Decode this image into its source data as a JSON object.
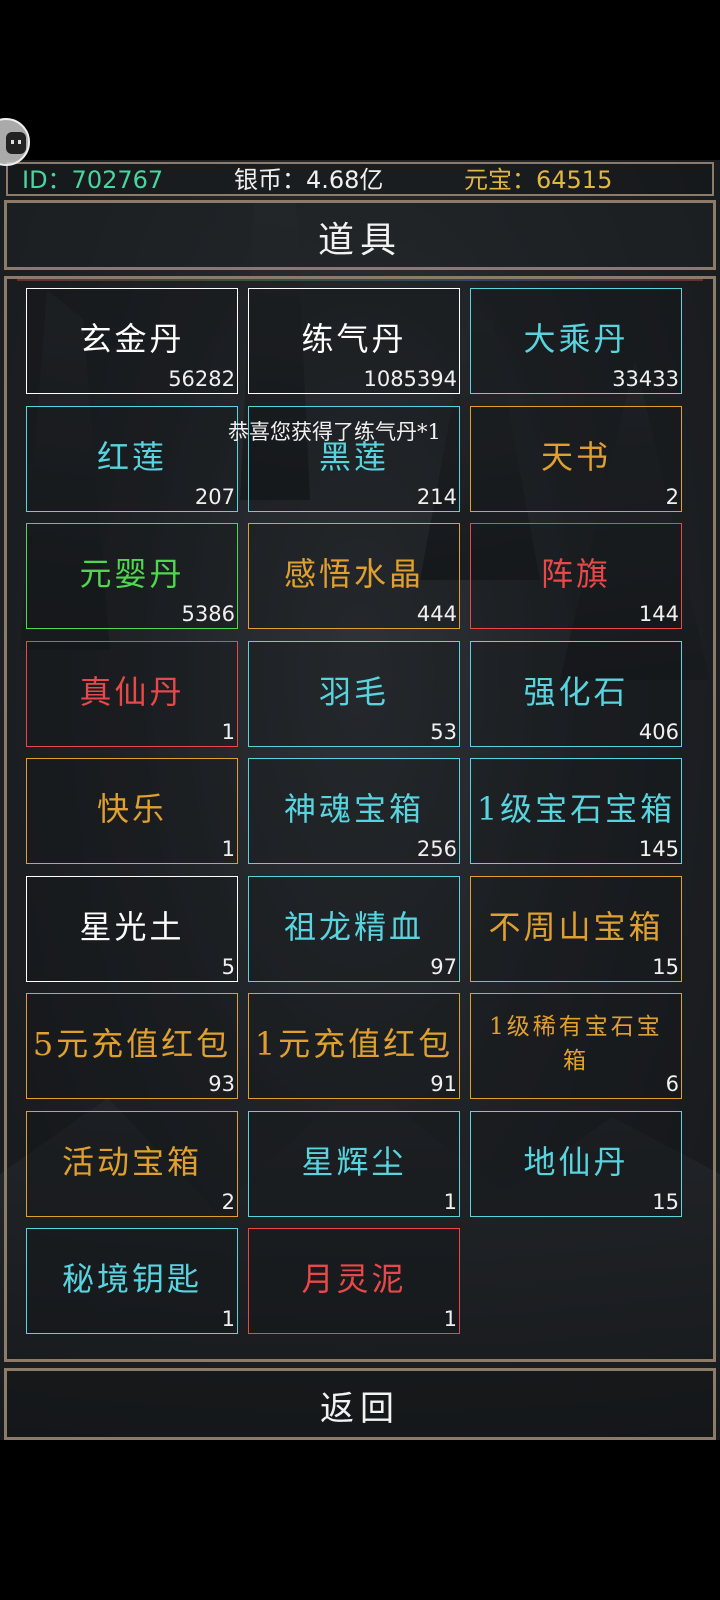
{
  "status": {
    "id_text": "ID：702767",
    "silver_text": "银币：4.68亿",
    "yuanbao_text": "元宝：64515",
    "colors": {
      "id": "#48d6a0",
      "silver": "#f0f0f0",
      "yuanbao": "#e0b840"
    }
  },
  "header": {
    "title": "道具"
  },
  "toast": "恭喜您获得了练气丹*1",
  "items": [
    {
      "name": "玄金丹",
      "count": "56282",
      "color": "#ffffff"
    },
    {
      "name": "练气丹",
      "count": "1085394",
      "color": "#ffffff"
    },
    {
      "name": "大乘丹",
      "count": "33433",
      "color": "#58d4df"
    },
    {
      "name": "红莲",
      "count": "207",
      "color": "#58d4df"
    },
    {
      "name": "黑莲",
      "count": "214",
      "color": "#58d4df"
    },
    {
      "name": "天书",
      "count": "2",
      "color": "#e0a030"
    },
    {
      "name": "元婴丹",
      "count": "5386",
      "color": "#4ed84e"
    },
    {
      "name": "感悟水晶",
      "count": "444",
      "color": "#e0a030"
    },
    {
      "name": "阵旗",
      "count": "144",
      "color": "#e84848"
    },
    {
      "name": "真仙丹",
      "count": "1",
      "color": "#e84848"
    },
    {
      "name": "羽毛",
      "count": "53",
      "color": "#58d4df"
    },
    {
      "name": "强化石",
      "count": "406",
      "color": "#58d4df"
    },
    {
      "name": "快乐",
      "count": "1",
      "color": "#e0a030"
    },
    {
      "name": "神魂宝箱",
      "count": "256",
      "color": "#58d4df"
    },
    {
      "name": "1级宝石宝箱",
      "count": "145",
      "color": "#58d4df"
    },
    {
      "name": "星光土",
      "count": "5",
      "color": "#ffffff"
    },
    {
      "name": "祖龙精血",
      "count": "97",
      "color": "#58d4df"
    },
    {
      "name": "不周山宝箱",
      "count": "15",
      "color": "#e0a030"
    },
    {
      "name": "5元充值红包",
      "count": "93",
      "color": "#e0a030"
    },
    {
      "name": "1元充值红包",
      "count": "91",
      "color": "#e0a030"
    },
    {
      "name": "1级稀有宝石宝箱",
      "count": "6",
      "color": "#e0a030",
      "small": true
    },
    {
      "name": "活动宝箱",
      "count": "2",
      "color": "#e0a030"
    },
    {
      "name": "星辉尘",
      "count": "1",
      "color": "#58d4df"
    },
    {
      "name": "地仙丹",
      "count": "15",
      "color": "#58d4df"
    },
    {
      "name": "秘境钥匙",
      "count": "1",
      "color": "#58d4df"
    },
    {
      "name": "月灵泥",
      "count": "1",
      "color": "#e84848"
    }
  ],
  "footer": {
    "back_label": "返回"
  }
}
